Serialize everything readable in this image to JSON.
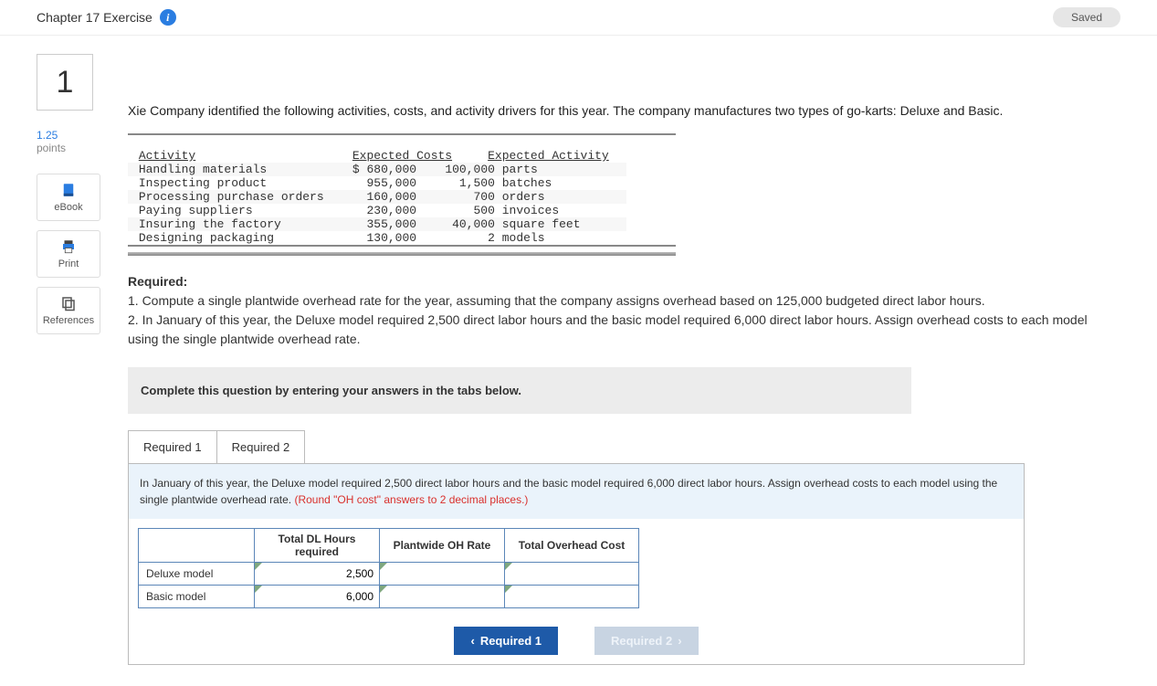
{
  "header": {
    "title": "Chapter 17 Exercise",
    "saved": "Saved"
  },
  "question_number": "1",
  "points": {
    "value": "1.25",
    "label": "points"
  },
  "tools": {
    "ebook": "eBook",
    "print": "Print",
    "references": "References"
  },
  "intro": "Xie Company identified the following activities, costs, and activity drivers for this year. The company manufactures two types of go-karts: Deluxe and Basic.",
  "activity_table": {
    "headers": {
      "activity": "Activity",
      "costs": "Expected Costs",
      "driver": "Expected Activity"
    },
    "rows": [
      {
        "activity": "Handling materials",
        "cost": "$ 680,000",
        "qty": "100,000",
        "unit": "parts"
      },
      {
        "activity": "Inspecting product",
        "cost": "955,000",
        "qty": "1,500",
        "unit": "batches"
      },
      {
        "activity": "Processing purchase orders",
        "cost": "160,000",
        "qty": "700",
        "unit": "orders"
      },
      {
        "activity": "Paying suppliers",
        "cost": "230,000",
        "qty": "500",
        "unit": "invoices"
      },
      {
        "activity": "Insuring the factory",
        "cost": "355,000",
        "qty": "40,000",
        "unit": "square feet"
      },
      {
        "activity": "Designing packaging",
        "cost": "130,000",
        "qty": "2",
        "unit": "models"
      }
    ]
  },
  "required": {
    "heading": "Required:",
    "r1": "1. Compute a single plantwide overhead rate for the year, assuming that the company assigns overhead based on 125,000 budgeted direct labor hours.",
    "r2": "2. In January of this year, the Deluxe model required 2,500 direct labor hours and the basic model required 6,000 direct labor hours. Assign overhead costs to each model using the single plantwide overhead rate."
  },
  "instruction": "Complete this question by entering your answers in the tabs below.",
  "tabs": {
    "r1": "Required 1",
    "r2": "Required 2"
  },
  "tab_desc": {
    "text": "In January of this year, the Deluxe model required 2,500 direct labor hours and the basic model required 6,000 direct labor hours. Assign overhead costs to each model using the single plantwide overhead rate. ",
    "hint": "(Round \"OH cost\" answers to 2 decimal places.)"
  },
  "answer_table": {
    "headers": {
      "blank": "",
      "dl": "Total DL Hours required",
      "rate": "Plantwide OH Rate",
      "total": "Total Overhead Cost"
    },
    "rows": [
      {
        "label": "Deluxe model",
        "dl": "2,500",
        "rate": "",
        "total": ""
      },
      {
        "label": "Basic model",
        "dl": "6,000",
        "rate": "",
        "total": ""
      }
    ]
  },
  "nav": {
    "prev": "Required 1",
    "next": "Required 2"
  }
}
